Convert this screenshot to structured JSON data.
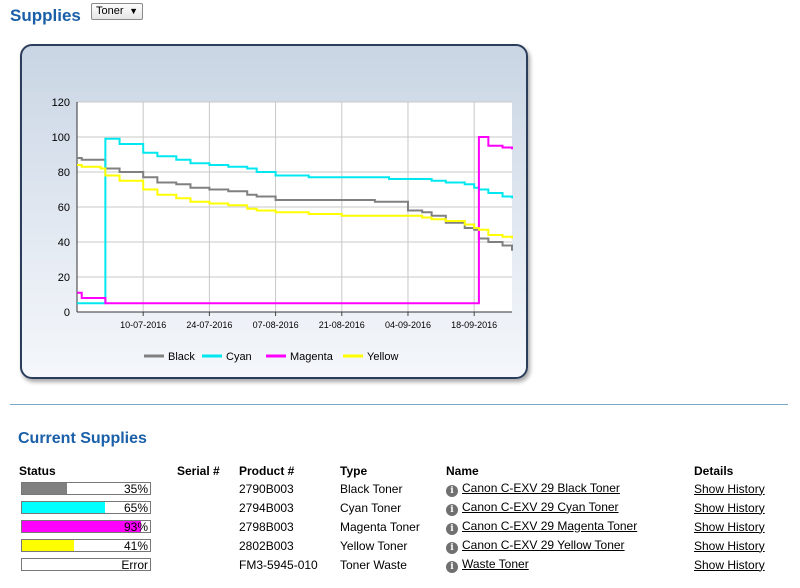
{
  "header": {
    "title": "Supplies",
    "select_value": "Toner"
  },
  "chart_data": {
    "type": "line",
    "x": [
      "26-06-2016",
      "27-06-2016",
      "01-07-2016",
      "02-07-2016",
      "05-07-2016",
      "10-07-2016",
      "13-07-2016",
      "17-07-2016",
      "20-07-2016",
      "24-07-2016",
      "28-07-2016",
      "01-08-2016",
      "03-08-2016",
      "07-08-2016",
      "14-08-2016",
      "21-08-2016",
      "28-08-2016",
      "31-08-2016",
      "04-09-2016",
      "07-09-2016",
      "09-09-2016",
      "12-09-2016",
      "16-09-2016",
      "18-09-2016",
      "19-09-2016",
      "21-09-2016",
      "24-09-2016",
      "26-09-2016"
    ],
    "x_ticks": [
      "10-07-2016",
      "24-07-2016",
      "07-08-2016",
      "21-08-2016",
      "04-09-2016",
      "18-09-2016"
    ],
    "ylim": [
      0,
      120
    ],
    "y_ticks": [
      "0",
      "20",
      "40",
      "60",
      "80",
      "100",
      "120"
    ],
    "series": [
      {
        "name": "Black",
        "color": "#808080",
        "values": [
          88,
          87,
          87,
          82,
          80,
          77,
          74,
          73,
          71,
          70,
          69,
          67,
          66,
          64,
          64,
          64,
          63,
          63,
          58,
          57,
          55,
          51,
          48,
          47,
          42,
          40,
          38,
          35
        ]
      },
      {
        "name": "Cyan",
        "color": "#00e8ef",
        "values": [
          5,
          5,
          5,
          99,
          96,
          91,
          89,
          87,
          85,
          84,
          83,
          82,
          80,
          78,
          77,
          77,
          77,
          76,
          76,
          76,
          75,
          74,
          73,
          71,
          70,
          68,
          66,
          65
        ]
      },
      {
        "name": "Magenta",
        "color": "#ff00ff",
        "values": [
          11,
          8,
          8,
          5,
          5,
          5,
          5,
          5,
          5,
          5,
          5,
          5,
          5,
          5,
          5,
          5,
          5,
          5,
          5,
          5,
          5,
          5,
          5,
          5,
          100,
          95,
          94,
          93
        ]
      },
      {
        "name": "Yellow",
        "color": "#ffff00",
        "values": [
          84,
          83,
          82,
          78,
          75,
          70,
          67,
          65,
          63,
          62,
          61,
          59,
          58,
          57,
          56,
          55,
          55,
          55,
          55,
          54,
          53,
          52,
          50,
          48,
          47,
          44,
          43,
          42
        ]
      }
    ],
    "legend_position": "bottom",
    "grid": true
  },
  "current": {
    "title": "Current Supplies",
    "columns": {
      "status": "Status",
      "serial": "Serial #",
      "product": "Product #",
      "type": "Type",
      "name": "Name",
      "details": "Details"
    },
    "rows": [
      {
        "level": 35,
        "color": "#808080",
        "pct": "35%",
        "serial": "",
        "product": "2790B003",
        "type": "Black Toner",
        "name": "Canon C-EXV 29 Black Toner",
        "details": "Show History"
      },
      {
        "level": 65,
        "color": "#00ffff",
        "pct": "65%",
        "serial": "",
        "product": "2794B003",
        "type": "Cyan Toner",
        "name": "Canon C-EXV 29 Cyan Toner",
        "details": "Show History"
      },
      {
        "level": 93,
        "color": "#ff00ff",
        "pct": "93%",
        "serial": "",
        "product": "2798B003",
        "type": "Magenta Toner",
        "name": "Canon C-EXV 29 Magenta Toner",
        "details": "Show History"
      },
      {
        "level": 41,
        "color": "#ffff00",
        "pct": "41%",
        "serial": "",
        "product": "2802B003",
        "type": "Yellow Toner",
        "name": "Canon C-EXV 29 Yellow Toner",
        "details": "Show History"
      },
      {
        "level": 0,
        "color": "#ffffff",
        "pct": "Error",
        "serial": "",
        "product": "FM3-5945-010",
        "type": "Toner Waste",
        "name": "Waste Toner",
        "details": "Show History"
      }
    ]
  }
}
